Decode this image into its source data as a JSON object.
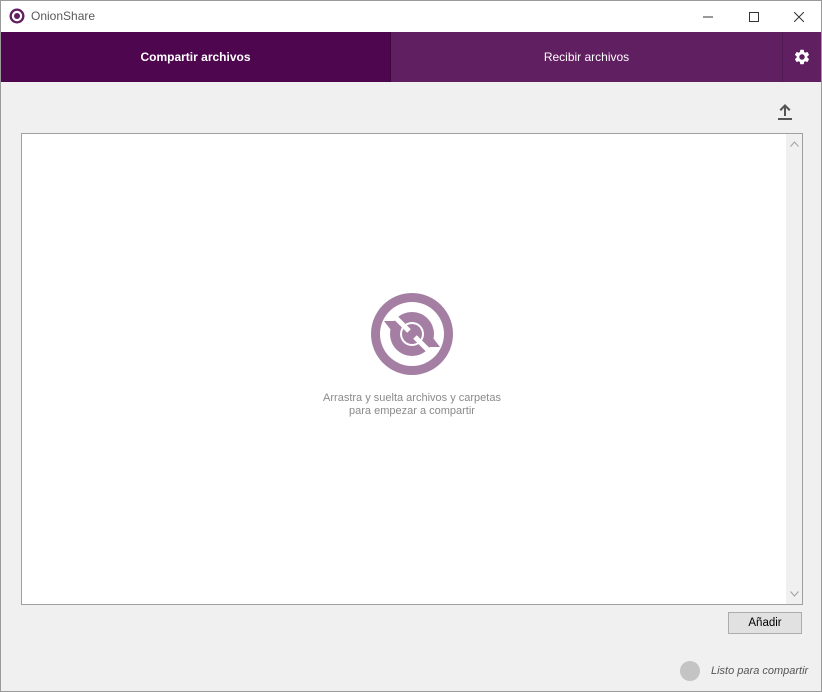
{
  "window": {
    "title": "OnionShare"
  },
  "modes": {
    "share_tab_label": "Compartir archivos",
    "receive_tab_label": "Recibir archivos"
  },
  "icons": {
    "app": "onionshare-logo-icon",
    "settings": "gear-icon",
    "history": "upload-arrow-icon",
    "drop_logo": "onionshare-arrows-logo-icon"
  },
  "drop_area": {
    "line1": "Arrastra y suelta archivos y carpetas",
    "line2": "para empezar a compartir"
  },
  "buttons": {
    "add_label": "Añadir"
  },
  "status": {
    "text": "Listo para compartir",
    "indicator_color": "#c4c4c4"
  },
  "colors": {
    "brand": "#601f61",
    "brand_active": "#4e064f",
    "logo": "#a47fa3"
  }
}
